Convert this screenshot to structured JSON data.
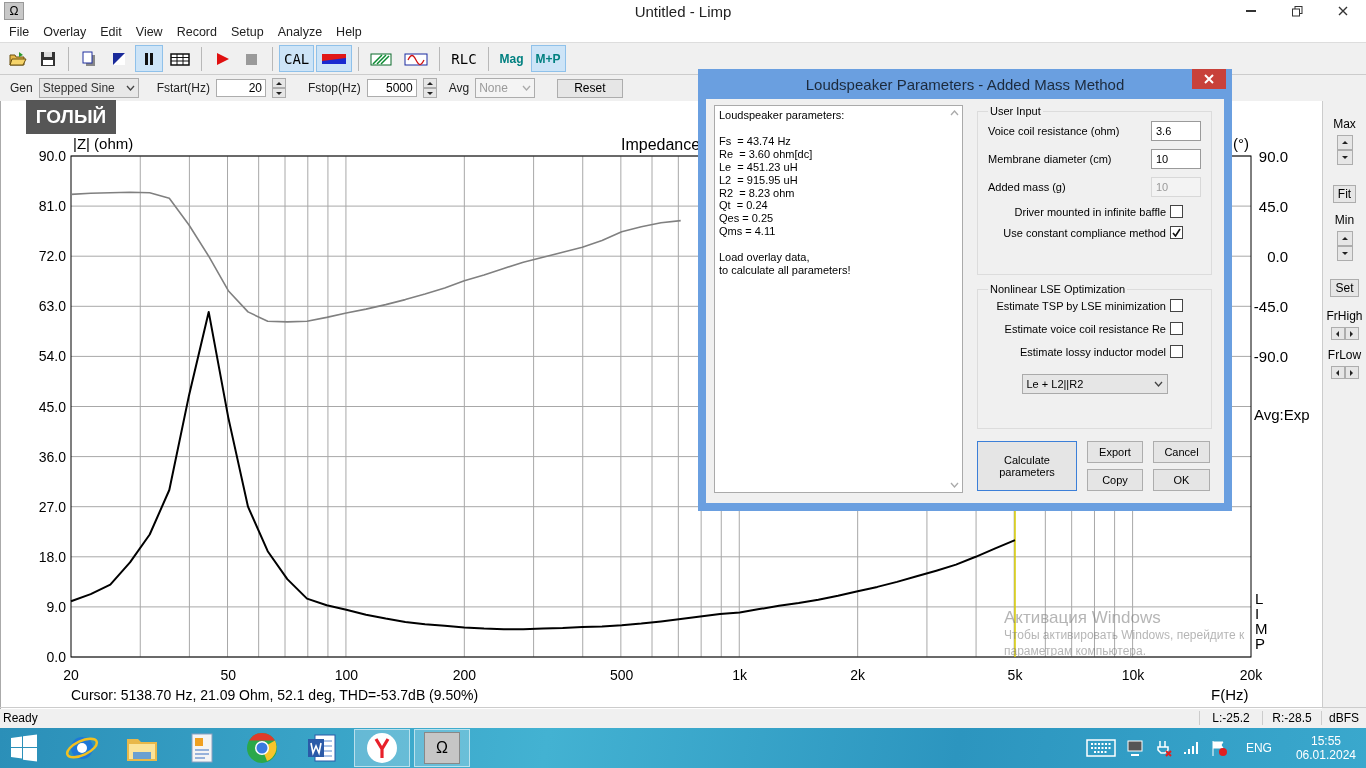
{
  "window": {
    "app_icon": "Ω",
    "title": "Untitled - Limp"
  },
  "menu": [
    "File",
    "Overlay",
    "Edit",
    "View",
    "Record",
    "Setup",
    "Analyze",
    "Help"
  ],
  "toolbar_groups": [
    [
      {
        "kind": "icon",
        "selected": false
      },
      {
        "kind": "icon",
        "selected": false
      }
    ],
    [
      {
        "kind": "icon",
        "selected": false
      },
      {
        "kind": "icon",
        "selected": false
      },
      {
        "kind": "icon",
        "selected": true
      },
      {
        "kind": "icon",
        "selected": false
      }
    ],
    [
      {
        "kind": "icon",
        "selected": false
      },
      {
        "kind": "icon",
        "selected": false
      }
    ],
    [
      {
        "kind": "text",
        "label": "CAL",
        "selected": true
      },
      {
        "kind": "icon",
        "selected": true
      }
    ],
    [
      {
        "kind": "icon",
        "selected": false
      },
      {
        "kind": "icon",
        "selected": false
      }
    ],
    [
      {
        "kind": "text",
        "label": "RLC",
        "selected": false
      }
    ],
    [
      {
        "kind": "mode",
        "label": "Mag",
        "selected": false
      },
      {
        "kind": "mode",
        "label": "M+P",
        "selected": true
      }
    ]
  ],
  "generator": {
    "gen_label": "Gen",
    "gen_value": "Stepped Sine",
    "fstart_label": "Fstart(Hz)",
    "fstart_value": "20",
    "fstop_label": "Fstop(Hz)",
    "fstop_value": "5000",
    "avg_label": "Avg",
    "avg_value": "None",
    "avg_disabled": true,
    "reset": "Reset"
  },
  "caption_overlay": "ГОЛЫЙ",
  "chart": {
    "phase_axis": {
      "label": "(°)",
      "ticks": [
        "90.0",
        "45.0",
        "0.0",
        "-45.0",
        "-90.0"
      ]
    },
    "avg_mode": "Avg:Exp",
    "side_letters": [
      "L",
      "I",
      "M",
      "P"
    ],
    "cursor_readout": "Cursor: 5138.70 Hz, 21.09 Ohm, 52.1 deg, THD=-53.7dB (9.50%)",
    "chart_data": {
      "type": "line",
      "title": "Impedance",
      "xlabel": "F(Hz)",
      "ylabel": "|Z| (ohm)",
      "grid": true,
      "categories": [
        "20",
        null,
        null,
        null,
        null,
        null,
        null,
        null,
        "50",
        null,
        null,
        null,
        null,
        null,
        "100",
        null,
        null,
        null,
        null,
        null,
        "200",
        null,
        null,
        null,
        null,
        null,
        null,
        null,
        "500",
        null,
        null,
        null,
        null,
        null,
        "1k",
        null,
        null,
        null,
        null,
        null,
        "2k",
        null,
        null,
        null,
        null,
        null,
        null,
        null,
        "5k",
        null,
        null,
        null,
        null,
        null,
        "10k",
        null,
        null,
        null,
        null,
        null,
        "20k"
      ],
      "series": [
        {
          "color": "#000000",
          "values": [
            10,
            11.3,
            13,
            17,
            22,
            30,
            47,
            62,
            43,
            27,
            19,
            14,
            10.5,
            9.3,
            8.5,
            7.6,
            6.9,
            6.3,
            5.9,
            5.6,
            5.3,
            5.1,
            5,
            5,
            5.1,
            5.2,
            5.4,
            5.5,
            5.7,
            6,
            6.4,
            6.8,
            7.3,
            7.7,
            8,
            8.6,
            9.2,
            9.7,
            10.3,
            11,
            11.8,
            12.6,
            13.5,
            14.5,
            15.5,
            16.6,
            18,
            19.5,
            21,
            null,
            null,
            null,
            null,
            null,
            null,
            null,
            null,
            null,
            null,
            null,
            null
          ]
        },
        {
          "color": "#808080",
          "values": [
            83.1,
            83.3,
            83.4,
            83.5,
            83.4,
            82.4,
            77.6,
            72,
            65.8,
            62,
            60.3,
            60.2,
            60.3,
            61,
            61.8,
            62.5,
            63.3,
            64.2,
            65.2,
            66.3,
            67.6,
            68.6,
            69.8,
            70.9,
            71.8,
            72.7,
            73.6,
            74.8,
            76.4,
            77.3,
            78,
            78.4,
            null,
            null,
            null,
            null,
            null,
            null,
            null,
            null,
            null,
            null,
            null,
            null,
            null,
            null,
            null,
            null,
            null,
            null,
            null,
            null,
            null,
            null,
            null,
            null,
            null,
            null,
            null,
            null,
            null
          ]
        }
      ],
      "ylim": [
        0,
        90
      ],
      "yticks": [
        {
          "value": 0,
          "label": "0.0"
        },
        {
          "value": 9,
          "label": "9.0"
        },
        {
          "value": 18,
          "label": "18.0"
        },
        {
          "value": 27,
          "label": "27.0"
        },
        {
          "value": 36,
          "label": "36.0"
        },
        {
          "value": 45,
          "label": "45.0"
        },
        {
          "value": 54,
          "label": "54.0"
        },
        {
          "value": 63,
          "label": "63.0"
        },
        {
          "value": 72,
          "label": "72.0"
        },
        {
          "value": 81,
          "label": "81.0"
        },
        {
          "value": 90,
          "label": "90.0"
        }
      ]
    }
  },
  "right_panel": {
    "max": "Max",
    "fit": "Fit",
    "min": "Min",
    "set": "Set",
    "fr_high": "FrHigh",
    "fr_low": "FrLow"
  },
  "status_bar": {
    "text": "Ready",
    "left_level": "L:-25.2",
    "right_level": "R:-28.5",
    "unit": "dBFS"
  },
  "dialog": {
    "title": "Loudspeaker Parameters - Added Mass Method",
    "report": [
      [
        "Loudspeaker parameters:"
      ],
      [
        "Fs  = 43.74 Hz",
        "Re  = 3.60 ohm[dc]",
        "Le  = 451.23 uH",
        "L2  = 915.95 uH",
        "R2  = 8.23 ohm",
        "Qt  = 0.24",
        "Qes = 0.25",
        "Qms = 4.11"
      ],
      [
        "Load overlay data,",
        "to calculate all parameters!"
      ]
    ],
    "user_input": {
      "title": "User Input",
      "fields": [
        {
          "label": "Voice coil resistance (ohm)",
          "value": "3.6",
          "disabled": false
        },
        {
          "label": "Membrane diameter (cm)",
          "value": "10",
          "disabled": false
        },
        {
          "label": "Added mass (g)",
          "value": "10",
          "disabled": true
        }
      ],
      "options": [
        {
          "label": "Driver mounted in infinite baffle",
          "checked": false
        },
        {
          "label": "Use constant compliance method",
          "checked": true
        }
      ]
    },
    "optimization": {
      "title": "Nonlinear LSE Optimization",
      "options": [
        {
          "label": "Estimate TSP by LSE minimization",
          "checked": false
        },
        {
          "label": "Estimate voice coil resistance Re",
          "checked": false
        },
        {
          "label": "Estimate lossy inductor model",
          "checked": false
        }
      ],
      "model": "Le + L2||R2"
    },
    "buttons": [
      {
        "label": "Calculate parameters",
        "default": true
      },
      {
        "label": "Export",
        "default": false
      },
      {
        "label": "Cancel",
        "default": false
      },
      {
        "label": "Copy",
        "default": false
      },
      {
        "label": "OK",
        "default": false
      }
    ]
  },
  "activation_notice": {
    "title": "Активация Windows",
    "lines": [
      "Чтобы активировать Windows, перейдите к",
      "параметрам компьютера."
    ]
  },
  "taskbar": {
    "apps": [
      {
        "active": false
      },
      {
        "active": false
      },
      {
        "active": false
      },
      {
        "active": false
      },
      {
        "active": false
      },
      {
        "active": true
      },
      {
        "active": true,
        "label": "Ω"
      }
    ],
    "language": "ENG",
    "time": "15:55",
    "date": "06.01.2024"
  }
}
